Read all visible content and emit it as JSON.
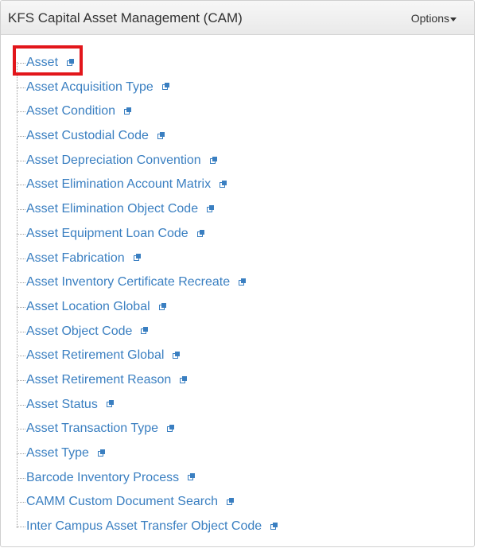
{
  "header": {
    "title": "KFS Capital Asset Management (CAM)",
    "options_label": "Options"
  },
  "links": [
    {
      "label": "Asset"
    },
    {
      "label": "Asset Acquisition Type"
    },
    {
      "label": "Asset Condition"
    },
    {
      "label": "Asset Custodial Code"
    },
    {
      "label": "Asset Depreciation Convention"
    },
    {
      "label": "Asset Elimination Account Matrix"
    },
    {
      "label": "Asset Elimination Object Code"
    },
    {
      "label": "Asset Equipment Loan Code"
    },
    {
      "label": "Asset Fabrication"
    },
    {
      "label": "Asset Inventory Certificate Recreate"
    },
    {
      "label": "Asset Location Global"
    },
    {
      "label": "Asset Object Code"
    },
    {
      "label": "Asset Retirement Global"
    },
    {
      "label": "Asset Retirement Reason"
    },
    {
      "label": "Asset Status"
    },
    {
      "label": "Asset Transaction Type"
    },
    {
      "label": "Asset Type"
    },
    {
      "label": "Barcode Inventory Process"
    },
    {
      "label": "CAMM Custom Document Search"
    },
    {
      "label": "Inter Campus Asset Transfer Object Code"
    }
  ],
  "colors": {
    "link": "#3a7fc1",
    "highlight": "#e2161b",
    "header_bg": "#eeeeee"
  },
  "icons": {
    "external_link": "external-link-icon",
    "options_caret": "caret-down-icon"
  }
}
